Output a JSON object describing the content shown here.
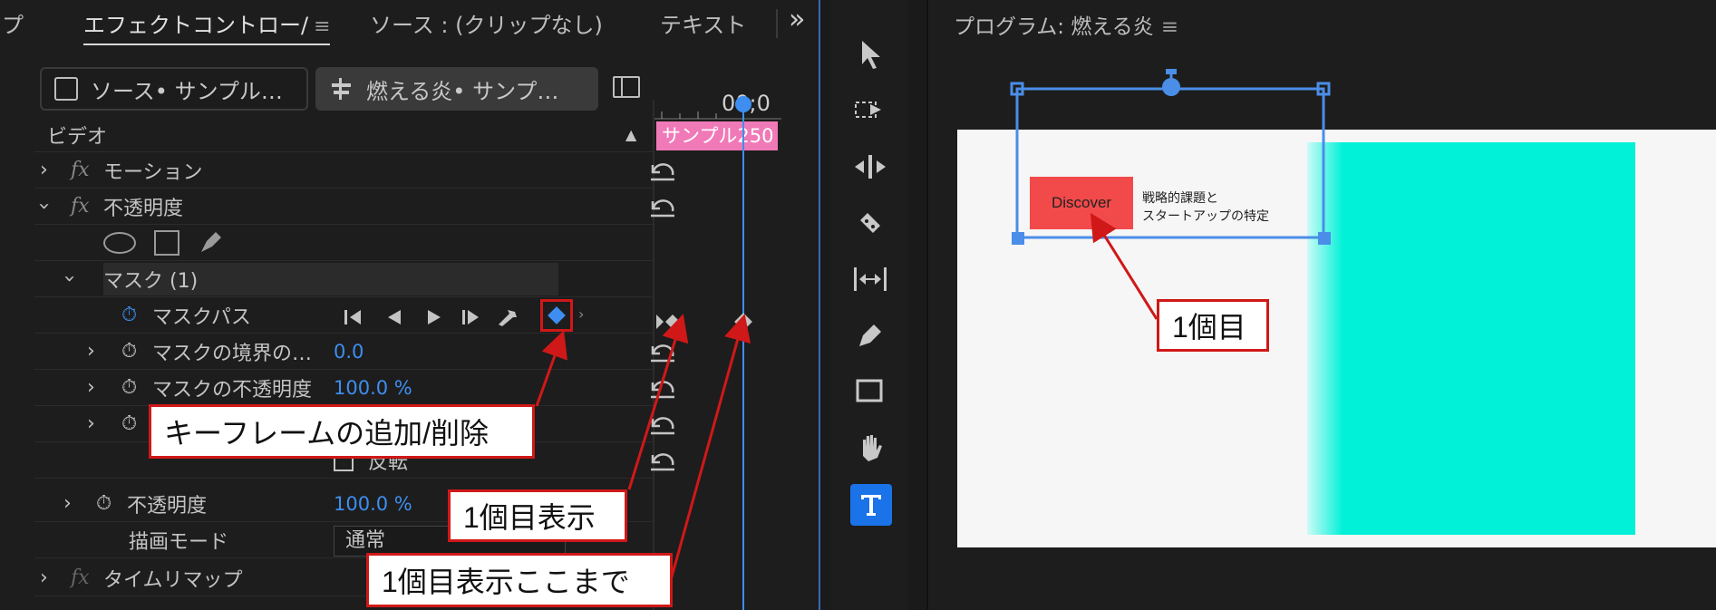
{
  "tabs": {
    "partial_left": "プ",
    "effect_controls": "エフェクトコントロー/",
    "source": "ソース : (クリップなし)",
    "text": "テキスト",
    "menu": "≡",
    "overflow": "»"
  },
  "clip_buttons": {
    "source": "ソース• サンプル…",
    "sequence": "燃える炎• サンプ…"
  },
  "timeline": {
    "timecode": "00;0",
    "clip_label": "サンプル250",
    "clip_color": "#f07ab8",
    "playhead_color": "#3d8ef0"
  },
  "effects": {
    "video_header": "ビデオ",
    "motion": "モーション",
    "opacity": "不透明度",
    "mask": "マスク (1)",
    "mask_path": "マスクパス",
    "mask_feather": "マスクの境界の…",
    "mask_feather_value": "0.0",
    "mask_opacity": "マスクの不透明度",
    "mask_opacity_value": "100.0 %",
    "invert": "反転",
    "opacity_prop": "不透明度",
    "opacity_value": "100.0 %",
    "blend_mode": "描画モード",
    "blend_value": "通常",
    "time_remap": "タイムリマップ"
  },
  "program": {
    "title": "プログラム: 燃える炎",
    "menu": "≡",
    "discover": "Discover",
    "caption_line1": "戦略的課題と",
    "caption_line2": "スタートアップの特定",
    "accent_cyan": "#00f0d8",
    "discover_color": "#f24a4a"
  },
  "callouts": {
    "add_remove_keyframe": "キーフレームの追加/削除",
    "first_display": "1個目表示",
    "first_display_until": "1個目表示ここまで",
    "first": "1個目"
  },
  "tools": [
    "select-tool",
    "track-select-tool",
    "ripple-edit-tool",
    "razor-tool",
    "slip-tool",
    "pen-tool",
    "rectangle-tool",
    "hand-tool",
    "type-tool"
  ]
}
